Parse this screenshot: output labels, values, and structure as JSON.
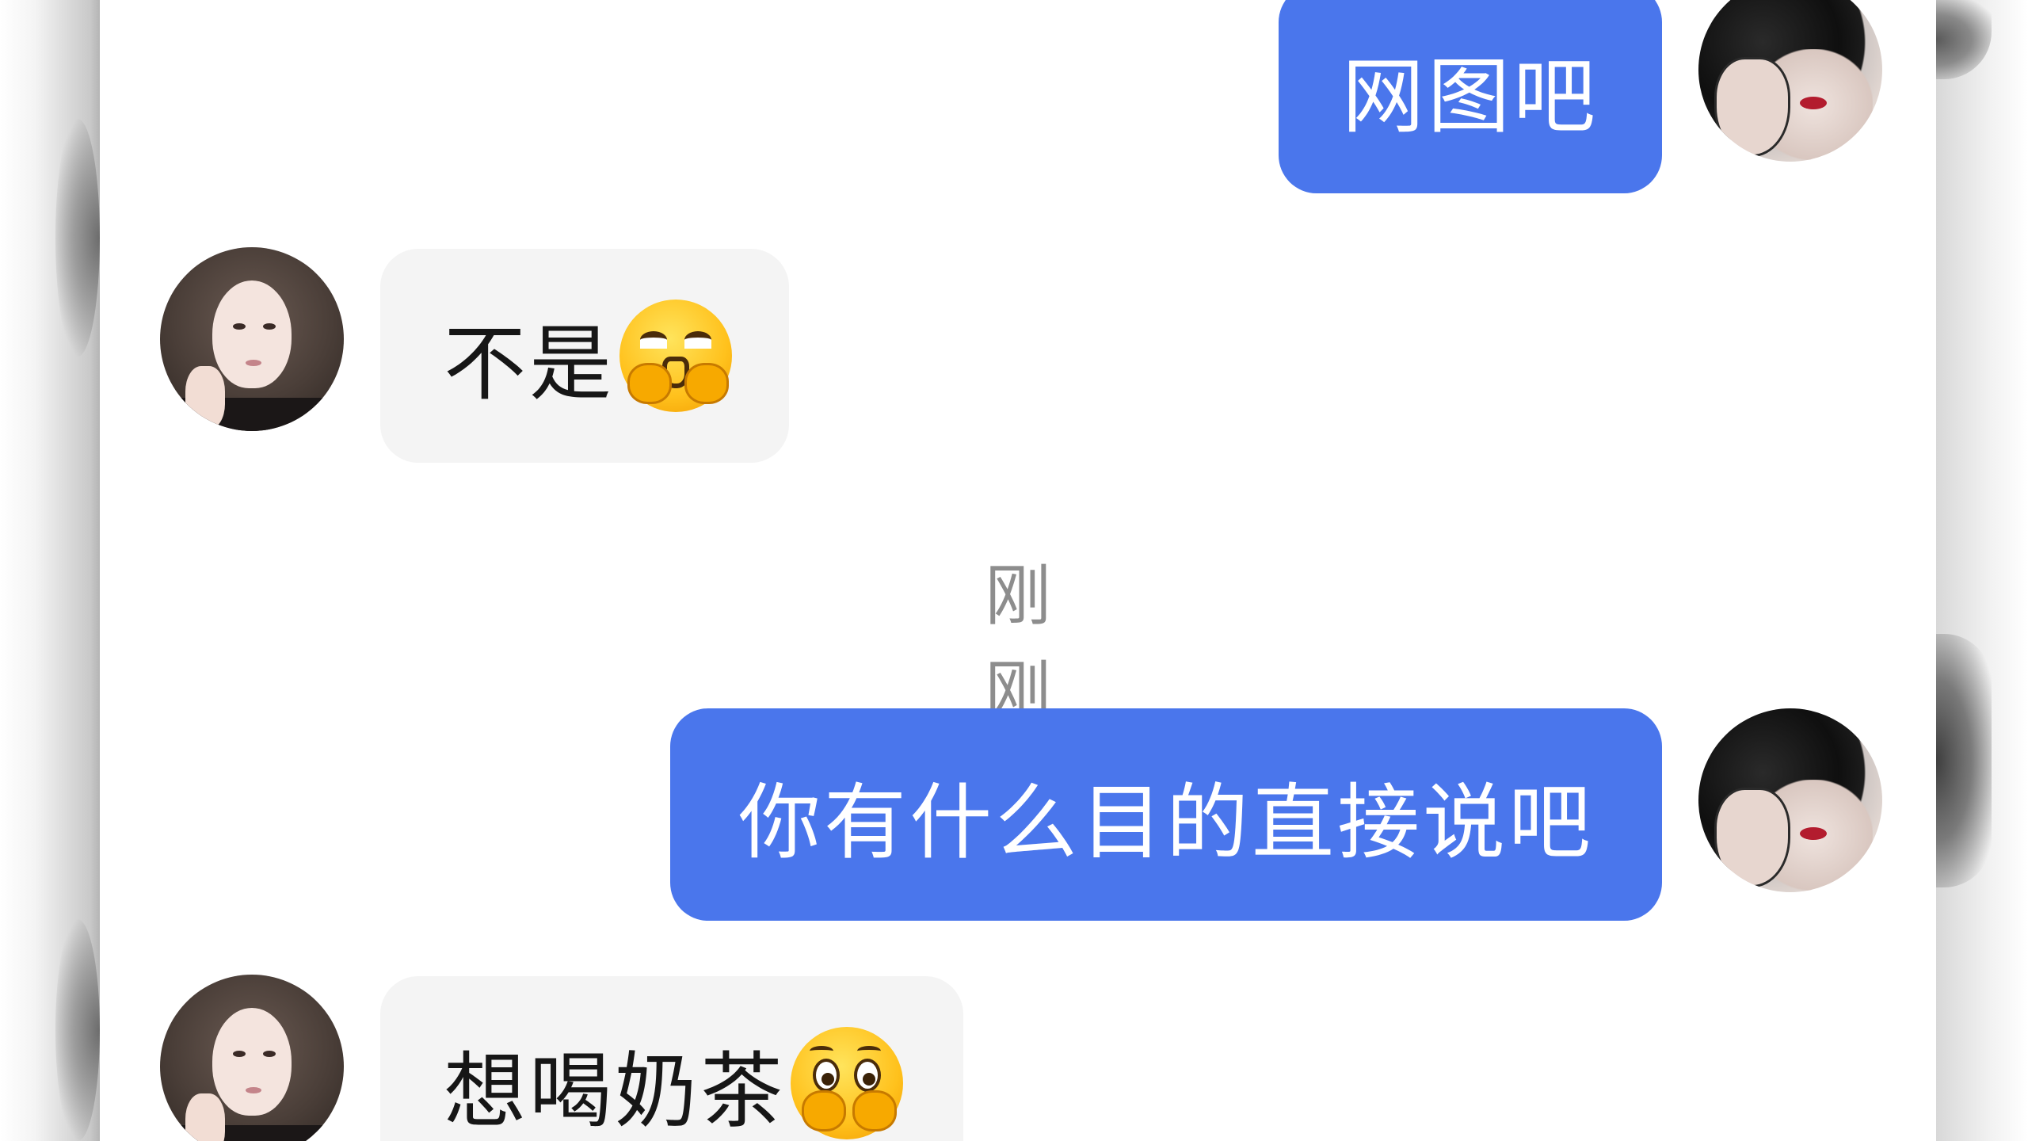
{
  "conversation": {
    "messages": [
      {
        "sender": "me",
        "text": "网图吧",
        "emoji": null
      },
      {
        "sender": "her",
        "text": "不是",
        "emoji": "pouting-face-emoji"
      },
      {
        "sender": "me",
        "text": "你有什么目的直接说吧",
        "emoji": null
      },
      {
        "sender": "her",
        "text": "想喝奶茶",
        "emoji": "pleading-face-emoji"
      }
    ],
    "timestamp_divider": "刚刚"
  },
  "theme": {
    "my_bubble_color": "#4a76ec",
    "their_bubble_color": "#f4f4f4",
    "timestamp_color": "#8d8d8d"
  }
}
